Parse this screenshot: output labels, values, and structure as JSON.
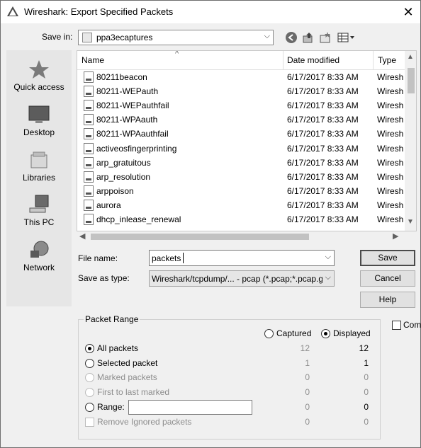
{
  "window": {
    "title": "Wireshark: Export Specified Packets"
  },
  "toolbar": {
    "save_in_label": "Save in:",
    "folder": "ppa3ecaptures"
  },
  "places": [
    {
      "label": "Quick access",
      "icon": "star-icon"
    },
    {
      "label": "Desktop",
      "icon": "desktop-icon"
    },
    {
      "label": "Libraries",
      "icon": "libraries-icon"
    },
    {
      "label": "This PC",
      "icon": "computer-icon"
    },
    {
      "label": "Network",
      "icon": "network-icon"
    }
  ],
  "filelist": {
    "columns": {
      "name": "Name",
      "date": "Date modified",
      "type": "Type"
    },
    "rows": [
      {
        "name": "80211beacon",
        "date": "6/17/2017 8:33 AM",
        "type": "Wiresh"
      },
      {
        "name": "80211-WEPauth",
        "date": "6/17/2017 8:33 AM",
        "type": "Wiresh"
      },
      {
        "name": "80211-WEPauthfail",
        "date": "6/17/2017 8:33 AM",
        "type": "Wiresh"
      },
      {
        "name": "80211-WPAauth",
        "date": "6/17/2017 8:33 AM",
        "type": "Wiresh"
      },
      {
        "name": "80211-WPAauthfail",
        "date": "6/17/2017 8:33 AM",
        "type": "Wiresh"
      },
      {
        "name": "activeosfingerprinting",
        "date": "6/17/2017 8:33 AM",
        "type": "Wiresh"
      },
      {
        "name": "arp_gratuitous",
        "date": "6/17/2017 8:33 AM",
        "type": "Wiresh"
      },
      {
        "name": "arp_resolution",
        "date": "6/17/2017 8:33 AM",
        "type": "Wiresh"
      },
      {
        "name": "arppoison",
        "date": "6/17/2017 8:33 AM",
        "type": "Wiresh"
      },
      {
        "name": "aurora",
        "date": "6/17/2017 8:33 AM",
        "type": "Wiresh"
      },
      {
        "name": "dhcp_inlease_renewal",
        "date": "6/17/2017 8:33 AM",
        "type": "Wiresh"
      }
    ]
  },
  "form": {
    "file_name_label": "File name:",
    "file_name_value": "packets",
    "save_as_label": "Save as type:",
    "save_as_value": "Wireshark/tcpdump/... - pcap (*.pcap;*.pcap.g:"
  },
  "buttons": {
    "save": "Save",
    "cancel": "Cancel",
    "help": "Help"
  },
  "compress_label": "Comp",
  "packet_range": {
    "title": "Packet Range",
    "captured_label": "Captured",
    "displayed_label": "Displayed",
    "rows": [
      {
        "label": "All packets",
        "captured": "12",
        "displayed": "12"
      },
      {
        "label": "Selected packet",
        "captured": "1",
        "displayed": "1"
      },
      {
        "label": "Marked packets",
        "captured": "0",
        "displayed": "0"
      },
      {
        "label": "First to last marked",
        "captured": "0",
        "displayed": "0"
      },
      {
        "label": "Range:",
        "captured": "0",
        "displayed": "0"
      },
      {
        "label": "Remove Ignored packets",
        "captured": "0",
        "displayed": "0"
      }
    ]
  }
}
